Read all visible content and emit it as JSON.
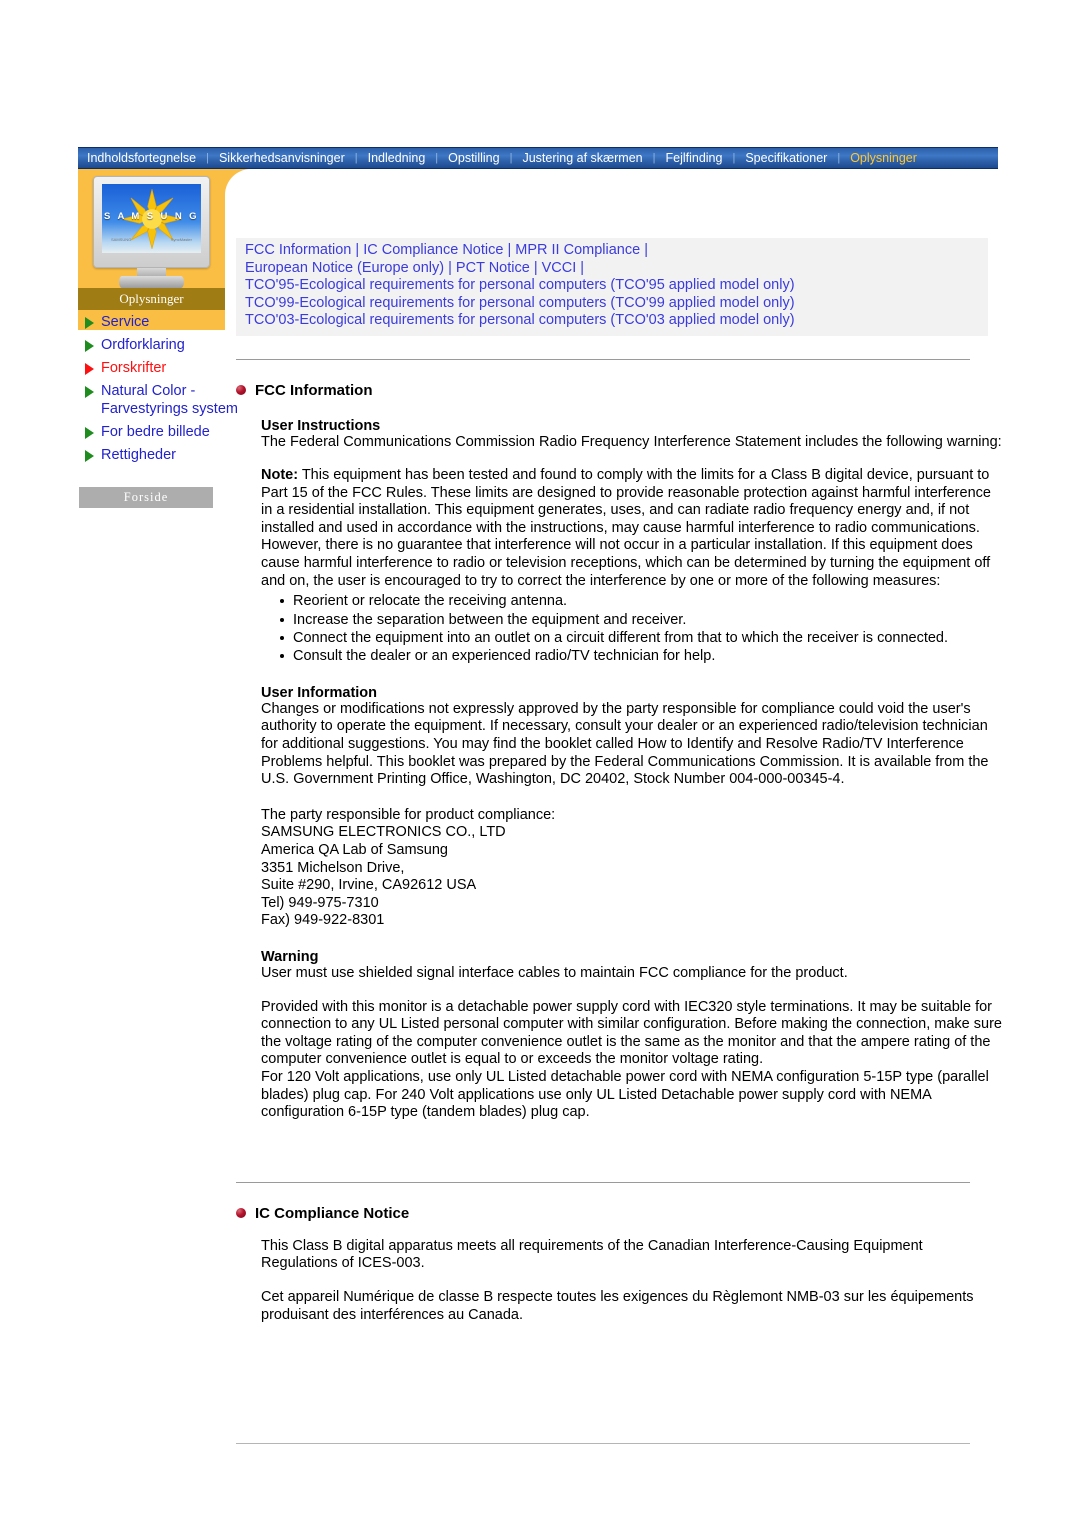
{
  "nav": {
    "items": [
      {
        "label": "Indholdsfortegnelse",
        "active": false
      },
      {
        "label": "Sikkerhedsanvisninger",
        "active": false
      },
      {
        "label": "Indledning",
        "active": false
      },
      {
        "label": "Opstilling",
        "active": false
      },
      {
        "label": "Justering af skærmen",
        "active": false
      },
      {
        "label": "Fejlfinding",
        "active": false
      },
      {
        "label": "Specifikationer",
        "active": false
      },
      {
        "label": "Oplysninger",
        "active": true
      }
    ],
    "separator": "|",
    "colors": {
      "bar_blue": "#2f63ad",
      "active_text": "#ffc62e",
      "text": "#ffffff"
    }
  },
  "sidebar": {
    "monitor_brand": "S A M S U N G",
    "monitor_label_left": "SAMSUNG",
    "monitor_label_right": "SyncMaster",
    "panel_caption": "Oplysninger",
    "items": [
      {
        "label": "Service",
        "active": false
      },
      {
        "label": "Ordforklaring",
        "active": false
      },
      {
        "label": "Forskrifter",
        "active": true
      },
      {
        "label": "Natural Color - Farvestyrings system",
        "active": false
      },
      {
        "label": "For bedre billede",
        "active": false
      },
      {
        "label": "Rettigheder",
        "active": false
      }
    ],
    "home_button": "Forside",
    "colors": {
      "panel_orange": "#fbbe44",
      "caption_brown": "#a07c14",
      "active_link": "#ff1010",
      "link": "#2222cc"
    }
  },
  "toplinks": {
    "row1": [
      "FCC Information",
      "IC Compliance Notice",
      "MPR II Compliance"
    ],
    "row2": [
      "European Notice (Europe only)",
      "PCT Notice",
      "VCCI"
    ],
    "row3": "TCO'95-Ecological requirements for personal computers (TCO'95 applied model only)",
    "row4": "TCO'99-Ecological requirements for personal computers (TCO'99 applied model only)",
    "row5": "TCO'03-Ecological requirements for personal computers (TCO'03 applied model only)",
    "separator": "|"
  },
  "fcc": {
    "heading": "FCC Information",
    "user_instructions_title": "User Instructions",
    "user_instructions_body": "The Federal Communications Commission Radio Frequency Interference Statement includes the following warning:",
    "note_label": "Note:",
    "note_body": " This equipment has been tested and found to comply with the limits for a Class B digital device, pursuant to Part 15 of the FCC Rules. These limits are designed to provide reasonable protection against harmful interference in a residential installation. This equipment generates, uses, and can radiate radio frequency energy and, if not installed and used in accordance with the instructions, may cause harmful interference to radio communications. However, there is no guarantee that interference will not occur in a particular installation. If this equipment does cause harmful interference to radio or television receptions, which can be determined by turning the equipment off and on, the user is encouraged to try to correct the interference by one or more of the following measures:",
    "measures": [
      "Reorient or relocate the receiving antenna.",
      "Increase the separation between the equipment and receiver.",
      "Connect the equipment into an outlet on a circuit different from that to which the receiver is connected.",
      "Consult the dealer or an experienced radio/TV technician for help."
    ],
    "user_information_title": "User Information",
    "user_information_body": "Changes or modifications not expressly approved by the party responsible for compliance could void the user's authority to operate the equipment. If necessary, consult your dealer or an experienced radio/television technician for additional suggestions. You may find the booklet called How to Identify and Resolve Radio/TV Interference Problems helpful. This booklet was prepared by the Federal Communications Commission. It is available from the U.S. Government Printing Office, Washington, DC 20402, Stock Number 004-000-00345-4.",
    "responsible_party": [
      "The party responsible for product compliance:",
      "SAMSUNG ELECTRONICS CO., LTD",
      "America QA Lab of Samsung",
      "3351 Michelson Drive,",
      "Suite #290, Irvine, CA92612 USA",
      "Tel) 949-975-7310",
      "Fax) 949-922-8301"
    ],
    "warning_title": "Warning",
    "warning_body": "User must use shielded signal interface cables to maintain FCC compliance for the product.",
    "cord_para": "Provided with this monitor is a detachable power supply cord with IEC320 style terminations. It may be suitable for connection to any UL Listed personal computer with similar configuration. Before making the connection, make sure the voltage rating of the computer convenience outlet is the same as the monitor and that the ampere rating of the computer convenience outlet is equal to or exceeds the monitor voltage rating.",
    "nema_para": "For 120 Volt applications, use only UL Listed detachable power cord with NEMA configuration 5-15P type (parallel blades) plug cap. For 240 Volt applications use only UL Listed Detachable power supply cord with NEMA configuration 6-15P type (tandem blades) plug cap."
  },
  "ic": {
    "heading": "IC Compliance Notice",
    "para_en": "This Class B digital apparatus meets all requirements of the Canadian Interference-Causing Equipment Regulations of ICES-003.",
    "para_fr": "Cet appareil Numérique de classe B respecte toutes les exigences du Règlemont NMB-03 sur les équipements produisant des interférences au Canada."
  }
}
